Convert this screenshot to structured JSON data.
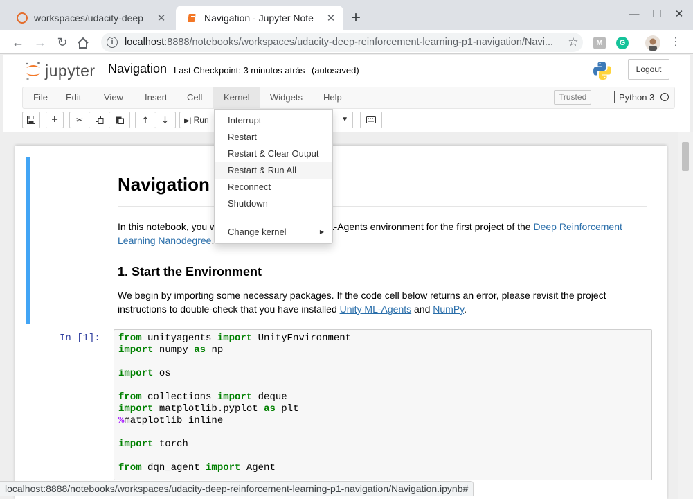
{
  "browser": {
    "tabs": [
      {
        "title": "workspaces/udacity-deep",
        "active": false
      },
      {
        "title": "Navigation - Jupyter Note",
        "active": true
      }
    ],
    "url_host": "localhost",
    "url_rest": ":8888/notebooks/workspaces/udacity-deep-reinforcement-learning-p1-navigation/Navi...",
    "status_url": "localhost:8888/notebooks/workspaces/udacity-deep-reinforcement-learning-p1-navigation/Navigation.ipynb#"
  },
  "jupyter": {
    "logo_text": "jupyter",
    "notebook_name": "Navigation",
    "checkpoint": "Last Checkpoint: 3 minutos atrás",
    "autosave": "(autosaved)",
    "logout": "Logout"
  },
  "menu": {
    "items": [
      "File",
      "Edit",
      "View",
      "Insert",
      "Cell",
      "Kernel",
      "Widgets",
      "Help"
    ],
    "open": "Kernel",
    "trusted": "Trusted",
    "kernel_name": "Python 3"
  },
  "toolbar": {
    "run_label": "Run"
  },
  "kernel_menu": {
    "items": [
      "Interrupt",
      "Restart",
      "Restart & Clear Output",
      "Restart & Run All",
      "Reconnect",
      "Shutdown"
    ],
    "hovered": "Restart & Run All",
    "change_kernel": "Change kernel"
  },
  "markdown": {
    "h1": "Navigation",
    "intro_before": "In this notebook, you w",
    "intro_middle": "y ML-Agents environment for the first project of the ",
    "link1": "Deep Reinforcement Learning Nanodegree",
    "intro_end": ".",
    "h2": "1. Start the Environment",
    "para2": "We begin by importing some necessary packages. If the code cell below returns an error, please revisit the project instructions to double-check that you have installed ",
    "link2": "Unity ML-Agents",
    "and": " and ",
    "link3": "NumPy",
    "period": "."
  },
  "code_cell": {
    "prompt": "In [1]:",
    "lines": [
      [
        {
          "t": "from",
          "k": "kw"
        },
        {
          "t": " unityagents "
        },
        {
          "t": "import",
          "k": "kw"
        },
        {
          "t": " UnityEnvironment"
        }
      ],
      [
        {
          "t": "import",
          "k": "kw"
        },
        {
          "t": " numpy "
        },
        {
          "t": "as",
          "k": "kw"
        },
        {
          "t": " np"
        }
      ],
      [],
      [
        {
          "t": "import",
          "k": "kw"
        },
        {
          "t": " os"
        }
      ],
      [],
      [
        {
          "t": "from",
          "k": "kw"
        },
        {
          "t": " collections "
        },
        {
          "t": "import",
          "k": "kw"
        },
        {
          "t": " deque"
        }
      ],
      [
        {
          "t": "import",
          "k": "kw"
        },
        {
          "t": " matplotlib.pyplot "
        },
        {
          "t": "as",
          "k": "kw"
        },
        {
          "t": " plt"
        }
      ],
      [
        {
          "t": "%",
          "k": "mg"
        },
        {
          "t": "matplotlib inline"
        }
      ],
      [],
      [
        {
          "t": "import",
          "k": "kw"
        },
        {
          "t": " torch"
        }
      ],
      [],
      [
        {
          "t": "from",
          "k": "kw"
        },
        {
          "t": " dqn_agent "
        },
        {
          "t": "import",
          "k": "kw"
        },
        {
          "t": " Agent"
        }
      ]
    ]
  },
  "colors": {
    "cell_selected_border": "#42a5f5",
    "keyword": "#008000",
    "magic": "#aa22ff",
    "prompt": "#303f9f",
    "link": "#296eaa"
  }
}
